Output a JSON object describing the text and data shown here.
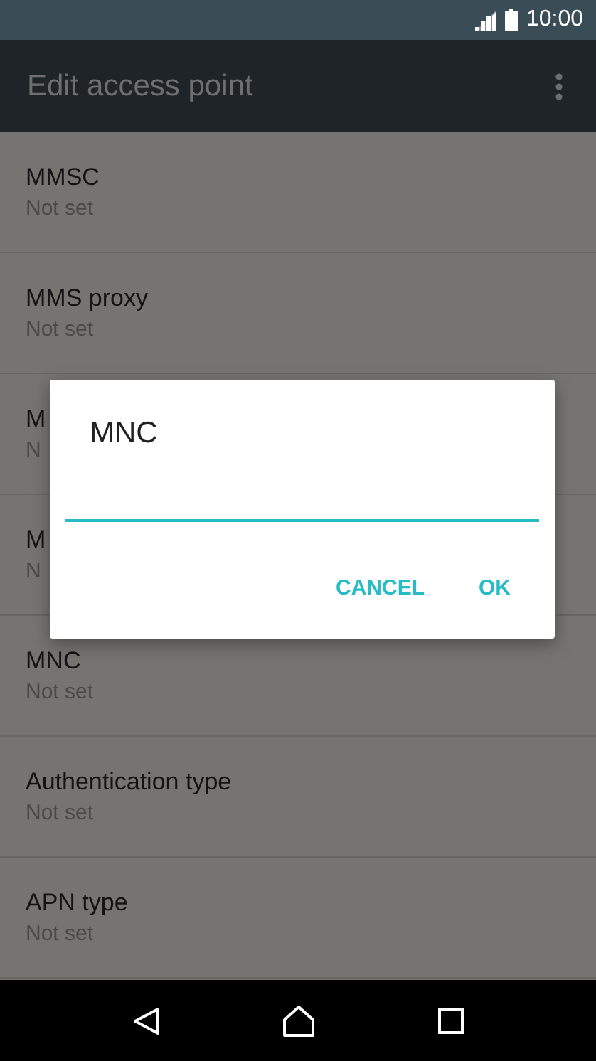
{
  "status_bar": {
    "time": "10:00"
  },
  "app_bar": {
    "title": "Edit access point"
  },
  "settings": [
    {
      "title": "MMSC",
      "summary": "Not set"
    },
    {
      "title": "MMS proxy",
      "summary": "Not set"
    },
    {
      "title": "M",
      "summary": "N"
    },
    {
      "title": "M",
      "summary": "N"
    },
    {
      "title": "MNC",
      "summary": "Not set"
    },
    {
      "title": "Authentication type",
      "summary": "Not set"
    },
    {
      "title": "APN type",
      "summary": "Not set"
    }
  ],
  "dialog": {
    "title": "MNC",
    "buttons": [
      "CANCEL",
      "OK"
    ]
  }
}
